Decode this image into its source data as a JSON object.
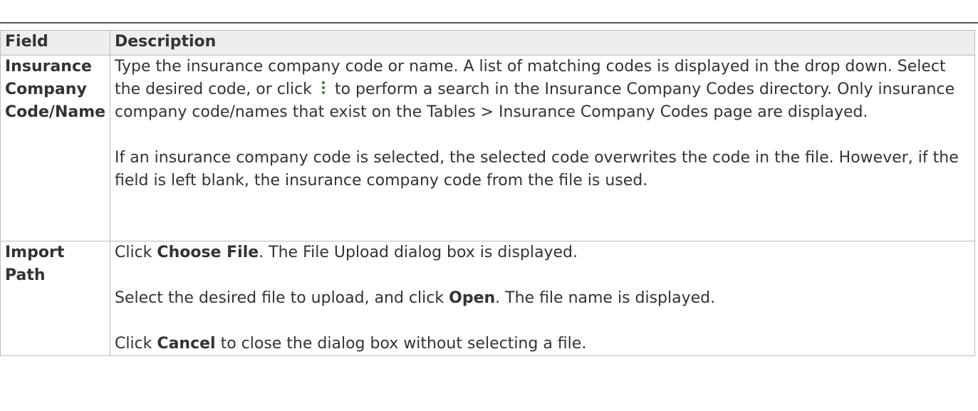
{
  "table": {
    "headers": {
      "field": "Field",
      "description": "Description"
    },
    "rows": [
      {
        "field": "Insurance Company Code/Name",
        "paragraphs": {
          "p1_before_icon": "Type the insurance company code or name. A list of matching codes is displayed in the drop down. Select the desired code, or click",
          "p1_after_icon": "to perform a search in the Insurance Company Codes directory. Only insurance company code/names that exist on the Tables > Insurance Company Codes page are displayed.",
          "p2": "If an insurance company code is selected, the selected code overwrites the code in the file. However, if the field is left blank, the insurance company code from the file is used."
        },
        "icon": "vertical-ellipsis-icon",
        "icon_color": "#3a8a3a"
      },
      {
        "field": "Import Path",
        "paragraphs": {
          "p1_a": "Click ",
          "p1_bold": "Choose File",
          "p1_b": ". The File Upload dialog box is displayed.",
          "p2_a": "Select the desired file to upload, and click ",
          "p2_bold": "Open",
          "p2_b": ". The file name is displayed.",
          "p3_a": "Click ",
          "p3_bold": "Cancel",
          "p3_b": " to close the dialog box without selecting a file."
        }
      }
    ]
  }
}
